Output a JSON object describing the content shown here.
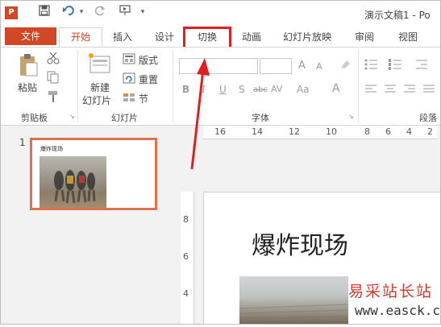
{
  "window": {
    "title": "演示文稿1 - Po",
    "app_icon": "powerpoint-icon"
  },
  "quick_access": {
    "icons": [
      "save-icon",
      "undo-icon",
      "redo-icon",
      "present-icon",
      "customize-icon"
    ],
    "dropdown_glyph": "▾"
  },
  "tabs": {
    "file": "文件",
    "home": "开始",
    "insert": "插入",
    "design": "设计",
    "transitions": "切换",
    "animations": "动画",
    "slideshow": "幻灯片放映",
    "review": "审阅",
    "view": "视图",
    "active": "开始",
    "highlighted": "切换",
    "highlight_color": "#e02020"
  },
  "ribbon": {
    "clipboard": {
      "paste": "粘贴",
      "group_label": "剪贴板"
    },
    "slides": {
      "new_slide_line1": "新建",
      "new_slide_line2": "幻灯片",
      "layout": "版式",
      "reset": "重置",
      "section": "节",
      "group_label": "幻灯片"
    },
    "font": {
      "bold": "B",
      "italic": "I",
      "underline": "U",
      "strikethrough": "S",
      "strike_abc": "abc",
      "spacing": "AV",
      "change_case": "Aa",
      "font_color": "A",
      "grow_font": "A",
      "shrink_font": "A",
      "group_label": "字体"
    },
    "paragraph": {
      "group_label": "段落"
    }
  },
  "thumbnails": [
    {
      "number": "1",
      "title": "爆炸现场",
      "selected": true,
      "border_color": "#e0714f"
    }
  ],
  "ruler_horizontal": [
    "16",
    "14",
    "12",
    "10",
    "8",
    "6",
    "4",
    "2"
  ],
  "ruler_vertical": [
    "8",
    "6",
    "4"
  ],
  "slide": {
    "title": "爆炸现场"
  },
  "watermark": {
    "text": "易采站长站",
    "url": "www.easck.com"
  },
  "colors": {
    "accent": "#d24726",
    "workspace": "#f2f2f2"
  }
}
